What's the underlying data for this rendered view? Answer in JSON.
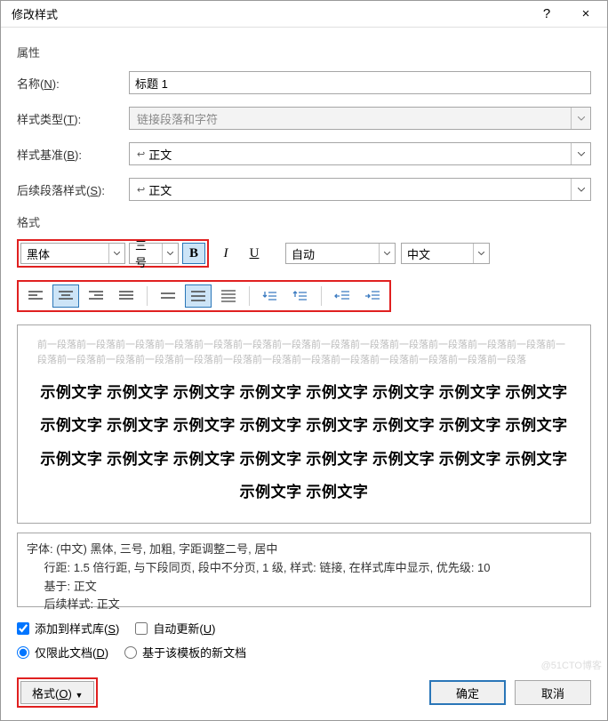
{
  "titlebar": {
    "title": "修改样式",
    "help": "?",
    "close": "×"
  },
  "props": {
    "section_label": "属性",
    "name_label": "名称(N):",
    "name_value": "标题 1",
    "type_label": "样式类型(T):",
    "type_value": "链接段落和字符",
    "based_label": "样式基准(B):",
    "based_value": "正文",
    "next_label": "后续段落样式(S):",
    "next_value": "正文"
  },
  "fmt": {
    "section_label": "格式",
    "font": "黑体",
    "size": "三号",
    "auto": "自动",
    "lang": "中文"
  },
  "preview": {
    "gray1": "前一段落前一段落前一段落前一段落前一段落前一段落前一段落前一段落前一段落前一段落前一段落前一段落前一段落前一段落前一段落前一段落前一段落前一段落前一段落前一段落前一段落前一段落前一段落前一段落前一段落前一段落",
    "sample": "示例文字 示例文字 示例文字 示例文字 示例文字 示例文字 示例文字 示例文字 示例文字 示例文字 示例文字 示例文字 示例文字 示例文字 示例文字 示例文字 示例文字 示例文字 示例文字 示例文字 示例文字 示例文字 示例文字 示例文字 示例文字 示例文字"
  },
  "desc": {
    "line1": "字体: (中文) 黑体, 三号, 加粗, 字距调整二号, 居中",
    "line2": "行距: 1.5 倍行距, 与下段同页, 段中不分页, 1 级, 样式: 链接, 在样式库中显示, 优先级: 10",
    "line3": "基于: 正文",
    "line4": "后续样式: 正文"
  },
  "checks": {
    "add_label": "添加到样式库(S)",
    "autoupdate_label": "自动更新(U)",
    "doc_label": "仅限此文档(D)",
    "template_label": "基于该模板的新文档"
  },
  "footer": {
    "format_label": "格式(O)",
    "ok_label": "确定",
    "cancel_label": "取消"
  },
  "watermark": "@51CTO博客"
}
